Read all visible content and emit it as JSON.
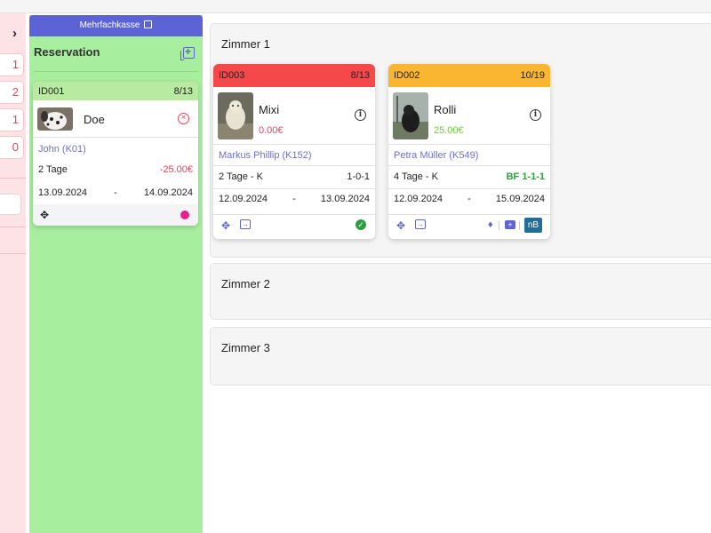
{
  "left_col": {
    "arrow": "›",
    "badges": [
      "1",
      "2",
      "1",
      "0"
    ]
  },
  "reservation": {
    "button_label": "Mehrfachkasse",
    "title": "Reservation",
    "card": {
      "id": "ID001",
      "ratio": "8/13",
      "name": "Doe",
      "owner": "John (K01)",
      "duration": "2 Tage",
      "amount": "-25.00€",
      "date_from": "13.09.2024",
      "date_sep": "-",
      "date_to": "14.09.2024",
      "head_color": "#b9eaa1",
      "status_color": "#e91e8c"
    }
  },
  "rooms": [
    {
      "title": "Zimmer 1",
      "cards": [
        {
          "id": "ID003",
          "ratio": "8/13",
          "name": "Mixi",
          "price": "0.00€",
          "owner": "Markus Phillip (K152)",
          "duration": "2 Tage - K",
          "code": "1-0-1",
          "date_from": "12.09.2024",
          "date_sep": "-",
          "date_to": "13.09.2024",
          "head_color": "#f4484a",
          "price_color": "#e0445c"
        },
        {
          "id": "ID002",
          "ratio": "10/19",
          "name": "Rolli",
          "price": "25.00€",
          "owner": "Petra Müller (K549)",
          "duration": "4 Tage - K",
          "code": "BF 1-1-1",
          "date_from": "12.09.2024",
          "date_sep": "-",
          "date_to": "15.09.2024",
          "head_color": "#fbb631",
          "price_color": "#6ccb3a",
          "badge": "nB"
        }
      ]
    },
    {
      "title": "Zimmer 2"
    },
    {
      "title": "Zimmer 3"
    }
  ],
  "icons": {
    "move": "move-icon",
    "checkout": "checkout-icon",
    "cancel": "cancel-icon",
    "info": "info-icon",
    "check": "check-circle-icon",
    "medicine": "medicine-icon",
    "medkit": "medkit-icon",
    "external": "external-link-icon",
    "add": "add-reservation-icon"
  },
  "colors": {
    "accent": "#5b63d6",
    "reservation_bg": "#a8ee9f",
    "left_bg": "#fde3e6"
  }
}
